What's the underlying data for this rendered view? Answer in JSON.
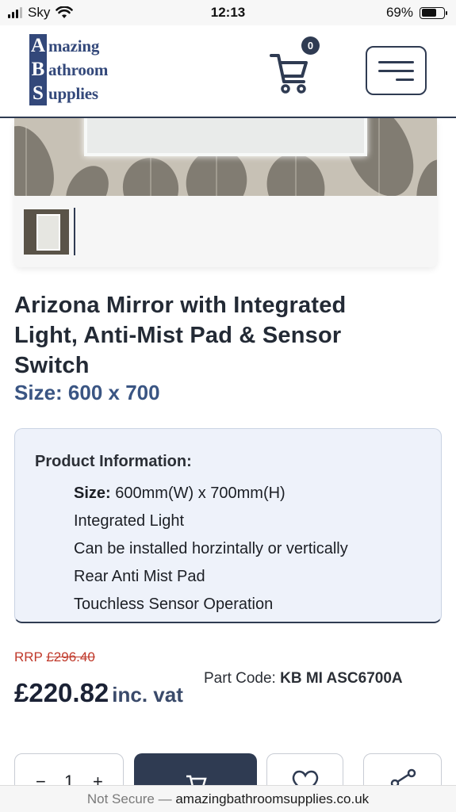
{
  "status_bar": {
    "carrier": "Sky",
    "time": "12:13",
    "battery_percent": "69%",
    "battery_level": 0.69
  },
  "header": {
    "logo": {
      "line1": {
        "initial": "A",
        "rest": "mazing"
      },
      "line2": {
        "initial": "B",
        "rest": "athroom"
      },
      "line3": {
        "initial": "S",
        "rest": "upplies"
      }
    },
    "cart_count": "0",
    "cart_icon": "shopping-cart-icon",
    "menu_icon": "hamburger-menu-icon"
  },
  "product": {
    "title": "Arizona Mirror with Integrated Light, Anti-Mist Pad & Sensor Switch",
    "size": "Size: 600 x 700",
    "info_title": "Product Information:",
    "info_items": [
      {
        "label": "Size:",
        "value": "600mm(W) x 700mm(H)"
      },
      {
        "label": "",
        "value": "Integrated Light"
      },
      {
        "label": "",
        "value": "Can be installed horzintally or vertically"
      },
      {
        "label": "",
        "value": "Rear Anti Mist Pad"
      },
      {
        "label": "",
        "value": "Touchless Sensor Operation"
      }
    ],
    "rrp_label": "RRP",
    "rrp_value": "£296.40",
    "price": "£220.82",
    "price_suffix": "inc. vat",
    "part_code_label": "Part Code:",
    "part_code_value": "KB MI ASC6700A"
  },
  "actions": {
    "quantity": "1",
    "decrement_icon": "minus-icon",
    "increment_icon": "plus-icon",
    "add_to_cart_icon": "cart-icon",
    "wishlist_icon": "heart-icon",
    "share_icon": "share-icon"
  },
  "url_bar": {
    "security": "Not Secure —",
    "host": "amazingbathroomsupplies.co.uk"
  },
  "colors": {
    "brand_navy": "#2f3b52",
    "logo_blue": "#33487a",
    "size_blue": "#3a5583",
    "rrp_red": "#c0392b",
    "info_bg": "#eef2fa"
  }
}
